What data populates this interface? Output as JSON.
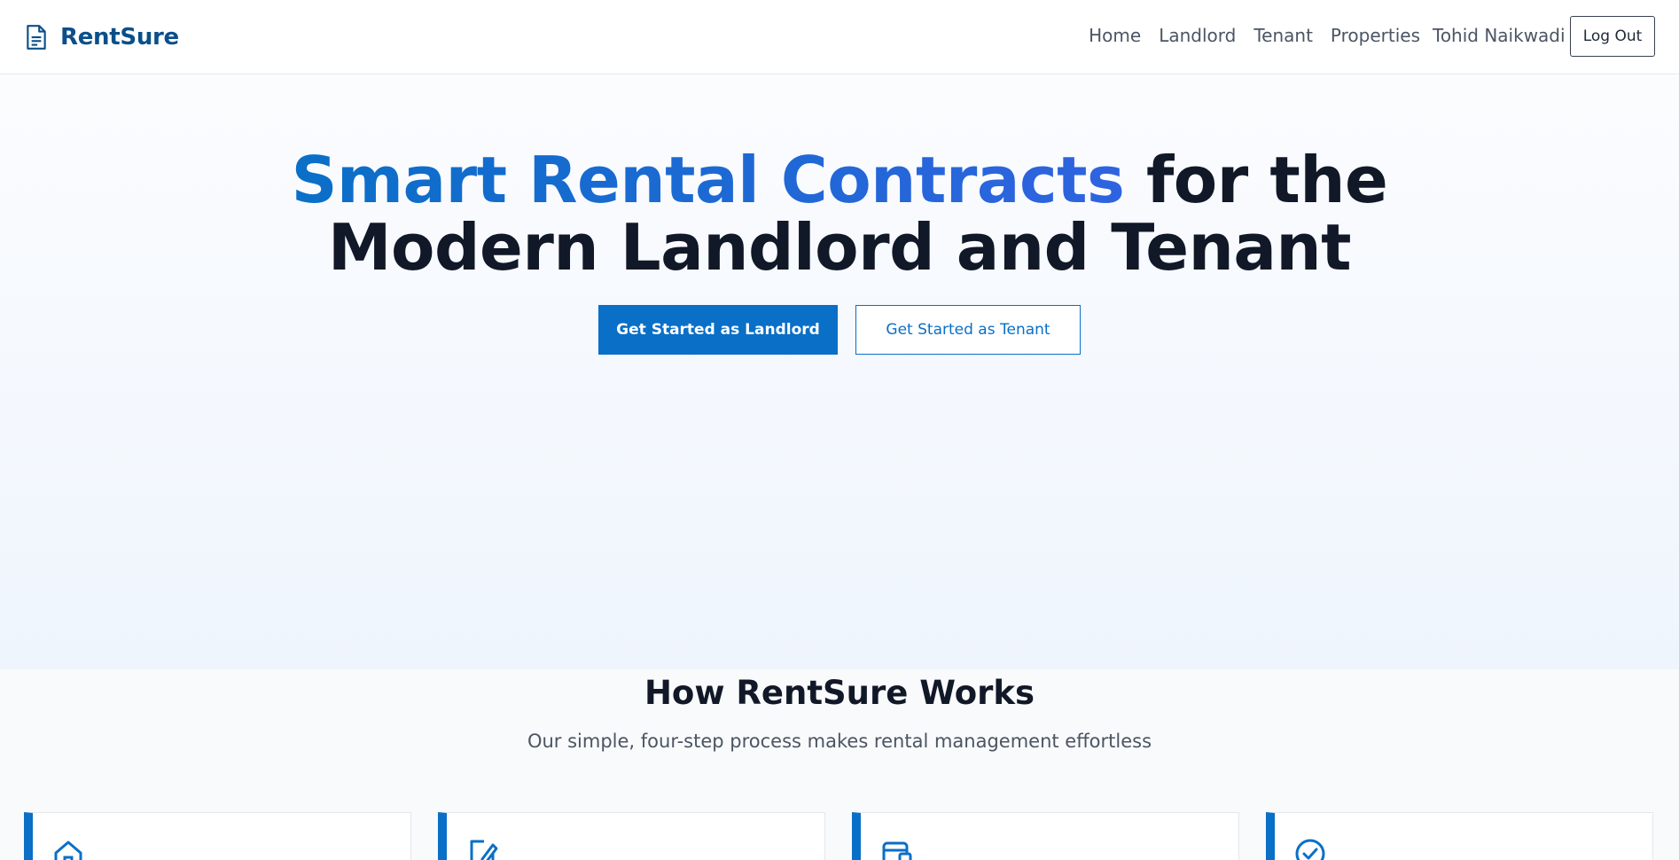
{
  "brand": {
    "name": "RentSure",
    "icon": "document-icon",
    "color": "#0b4f8a"
  },
  "nav": {
    "items": [
      "Home",
      "Landlord",
      "Tenant",
      "Properties"
    ],
    "user_name": "Tohid Naikwadi",
    "logout_label": "Log Out"
  },
  "hero": {
    "title_highlight": "Smart Rental Contracts",
    "title_line1_rest": "for the",
    "title_line2": "Modern Landlord and Tenant",
    "primary_button": "Get Started as Landlord",
    "secondary_button": "Get Started as Tenant"
  },
  "how": {
    "title": "How RentSure Works",
    "subtitle": "Our simple, four-step process makes rental management effortless",
    "cards": [
      {
        "icon": "home-icon"
      },
      {
        "icon": "edit-document-icon"
      },
      {
        "icon": "wallet-icon"
      },
      {
        "icon": "check-circle-icon"
      }
    ]
  },
  "colors": {
    "accent": "#0a6fc7",
    "accent_gradient_end": "#2f63e0",
    "heading": "#111827",
    "muted": "#4b5563"
  }
}
